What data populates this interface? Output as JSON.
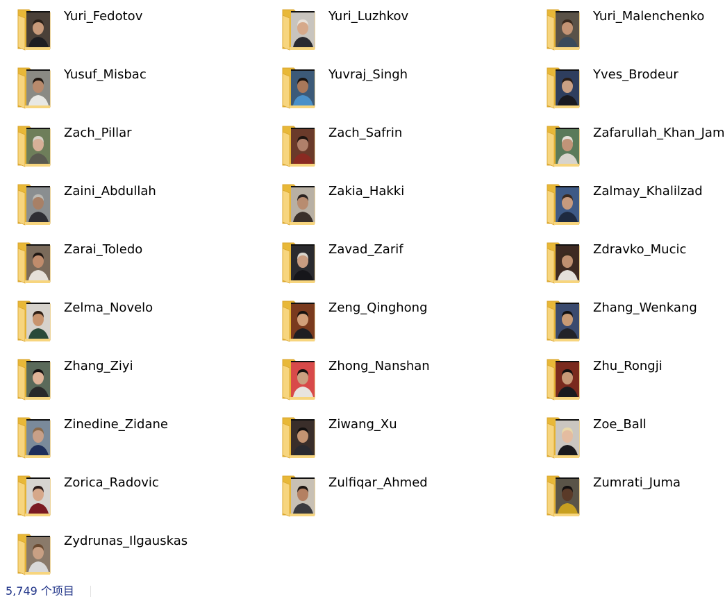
{
  "folders": [
    {
      "name": "Yuri_Fedotov",
      "thumb": {
        "bg": "#4a4038",
        "skin": "#c89a7a",
        "hair": "#2a2018",
        "shirt": "#1e1e22"
      }
    },
    {
      "name": "Yuri_Luzhkov",
      "thumb": {
        "bg": "#c8c4be",
        "skin": "#d6a98a",
        "hair": "#e8e2da",
        "shirt": "#2a2a30"
      }
    },
    {
      "name": "Yuri_Malenchenko",
      "thumb": {
        "bg": "#5a5248",
        "skin": "#c49474",
        "hair": "#3a2a1e",
        "shirt": "#3a4a5a"
      }
    },
    {
      "name": "Yusuf_Misbac",
      "thumb": {
        "bg": "#8a8a84",
        "skin": "#b88a6c",
        "hair": "#201812",
        "shirt": "#e8e8e4"
      }
    },
    {
      "name": "Yuvraj_Singh",
      "thumb": {
        "bg": "#3c5a78",
        "skin": "#a8785a",
        "hair": "#1a1410",
        "shirt": "#4a90c8"
      }
    },
    {
      "name": "Yves_Brodeur",
      "thumb": {
        "bg": "#2e3e5e",
        "skin": "#caa084",
        "hair": "#2a1e16",
        "shirt": "#1a1a20"
      }
    },
    {
      "name": "Zach_Pillar",
      "thumb": {
        "bg": "#6e7e5a",
        "skin": "#d8b098",
        "hair": "#d6d0c6",
        "shirt": "#5a5a50"
      }
    },
    {
      "name": "Zach_Safrin",
      "thumb": {
        "bg": "#6a3a2a",
        "skin": "#b0806a",
        "hair": "#1e1410",
        "shirt": "#8a2a22"
      }
    },
    {
      "name": "Zafarullah_Khan_Jama",
      "thumb": {
        "bg": "#5a7a5a",
        "skin": "#c09478",
        "hair": "#e4e0d8",
        "shirt": "#d8d4cc"
      }
    },
    {
      "name": "Zaini_Abdullah",
      "thumb": {
        "bg": "#8a8e90",
        "skin": "#a88066",
        "hair": "#bcbab4",
        "shirt": "#2e2e34"
      }
    },
    {
      "name": "Zakia_Hakki",
      "thumb": {
        "bg": "#b8b0a4",
        "skin": "#b88c70",
        "hair": "#2a2220",
        "shirt": "#3a302a"
      }
    },
    {
      "name": "Zalmay_Khalilzad",
      "thumb": {
        "bg": "#3e5a86",
        "skin": "#c69a7e",
        "hair": "#3a2a20",
        "shirt": "#1e2a40"
      }
    },
    {
      "name": "Zarai_Toledo",
      "thumb": {
        "bg": "#7a6a5a",
        "skin": "#c08c6c",
        "hair": "#1e1612",
        "shirt": "#e6e0d8"
      }
    },
    {
      "name": "Zavad_Zarif",
      "thumb": {
        "bg": "#2a2a2e",
        "skin": "#c89c80",
        "hair": "#d8d4cc",
        "shirt": "#16161a"
      }
    },
    {
      "name": "Zdravko_Mucic",
      "thumb": {
        "bg": "#3e2a22",
        "skin": "#c09070",
        "hair": "#3a2a1e",
        "shirt": "#e4e0da"
      }
    },
    {
      "name": "Zelma_Novelo",
      "thumb": {
        "bg": "#d6d2cc",
        "skin": "#c8946e",
        "hair": "#2e1e14",
        "shirt": "#2a4a3a"
      }
    },
    {
      "name": "Zeng_Qinghong",
      "thumb": {
        "bg": "#7a3a1e",
        "skin": "#d2a07a",
        "hair": "#161210",
        "shirt": "#1e1e22"
      }
    },
    {
      "name": "Zhang_Wenkang",
      "thumb": {
        "bg": "#3a4a6e",
        "skin": "#c89a74",
        "hair": "#121010",
        "shirt": "#222228"
      }
    },
    {
      "name": "Zhang_Ziyi",
      "thumb": {
        "bg": "#5a6a5a",
        "skin": "#e0b498",
        "hair": "#141010",
        "shirt": "#2a2a2a"
      }
    },
    {
      "name": "Zhong_Nanshan",
      "thumb": {
        "bg": "#d84a4a",
        "skin": "#caa080",
        "hair": "#161210",
        "shirt": "#e8e4e0"
      }
    },
    {
      "name": "Zhu_Rongji",
      "thumb": {
        "bg": "#7a2a1e",
        "skin": "#c89a78",
        "hair": "#121010",
        "shirt": "#1a1a1e"
      }
    },
    {
      "name": "Zinedine_Zidane",
      "thumb": {
        "bg": "#7a8a9a",
        "skin": "#c8a088",
        "hair": "#8a6a4a",
        "shirt": "#1e2e5a"
      }
    },
    {
      "name": "Ziwang_Xu",
      "thumb": {
        "bg": "#3a2e2a",
        "skin": "#c49472",
        "hair": "#121010",
        "shirt": "#2a2a30"
      }
    },
    {
      "name": "Zoe_Ball",
      "thumb": {
        "bg": "#cac6c0",
        "skin": "#e4bca0",
        "hair": "#e8d8a8",
        "shirt": "#1a1a1e"
      }
    },
    {
      "name": "Zorica_Radovic",
      "thumb": {
        "bg": "#d6d4d0",
        "skin": "#d6a88a",
        "hair": "#2a1a18",
        "shirt": "#7a1a22"
      }
    },
    {
      "name": "Zulfiqar_Ahmed",
      "thumb": {
        "bg": "#c8c0b4",
        "skin": "#b48062",
        "hair": "#1e1612",
        "shirt": "#3a3a3e"
      }
    },
    {
      "name": "Zumrati_Juma",
      "thumb": {
        "bg": "#5a5448",
        "skin": "#5a3a28",
        "hair": "#141010",
        "shirt": "#c8a020"
      }
    },
    {
      "name": "Zydrunas_Ilgauskas",
      "thumb": {
        "bg": "#8a7a6a",
        "skin": "#c8a084",
        "hair": "#6a4a30",
        "shirt": "#d8d8d8"
      }
    }
  ],
  "status": {
    "item_count": "5,749 个项目"
  },
  "colors": {
    "folder_back": "#e8b838",
    "folder_front": "#f7d57e",
    "folder_edge": "#d9a42c",
    "label_text": "#000000",
    "status_text": "#1e3287"
  }
}
